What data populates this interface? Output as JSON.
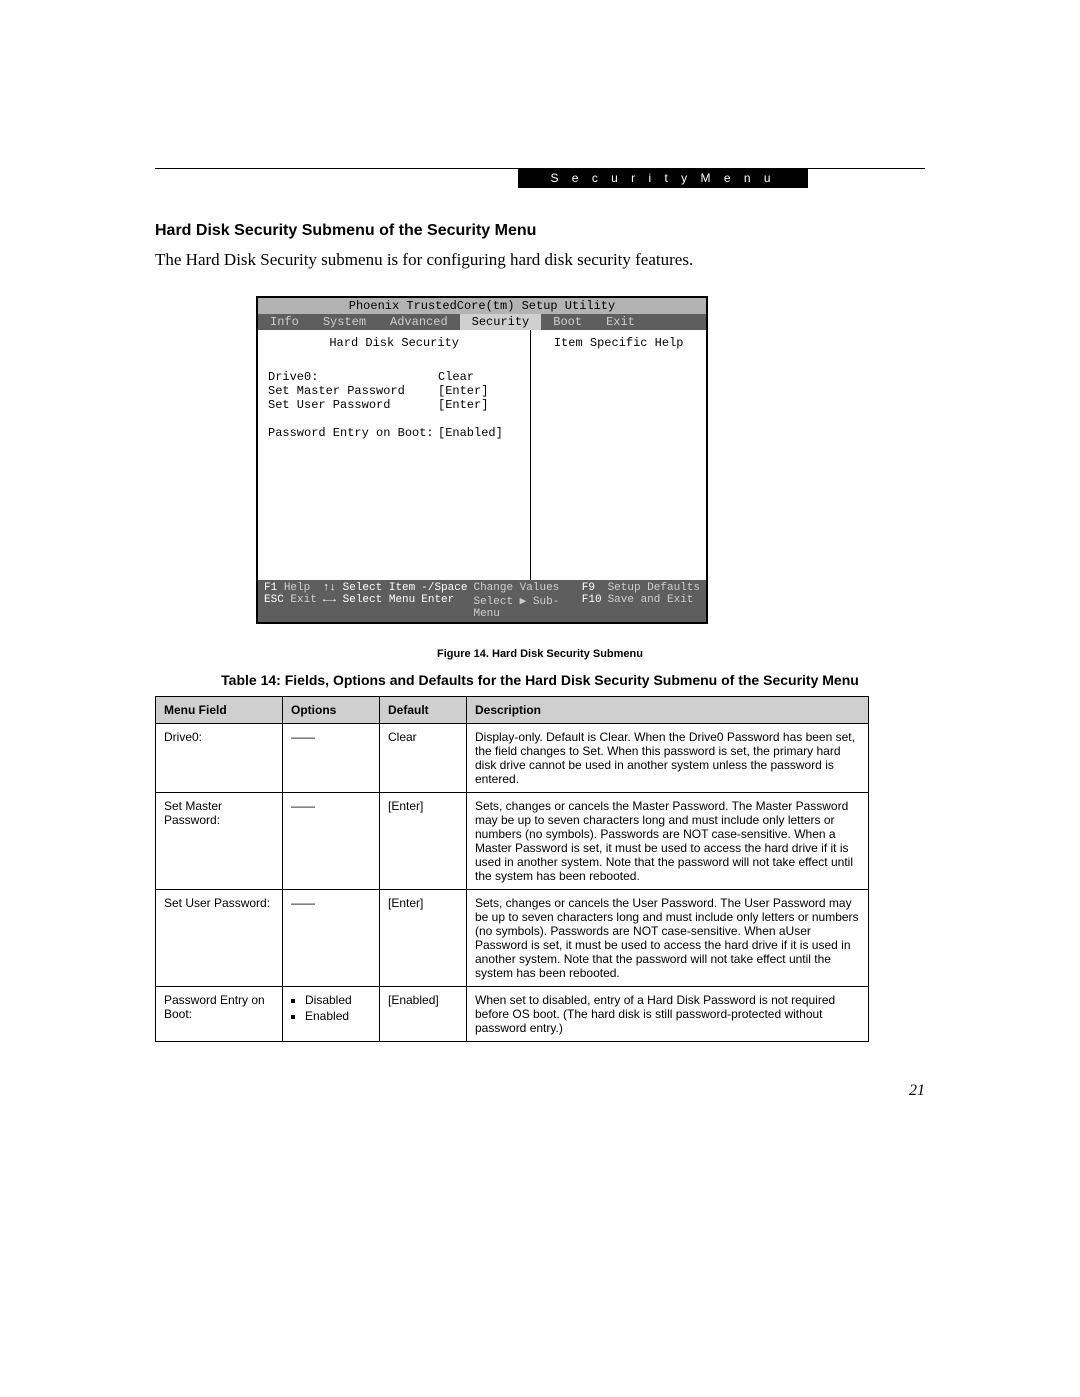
{
  "chip": "S e c u r i t y   M e n u",
  "heading": "Hard Disk Security Submenu of the Security Menu",
  "subtext": "The Hard Disk Security submenu is for configuring hard disk security features.",
  "pageNumber": "21",
  "bios": {
    "title": "Phoenix TrustedCore(tm) Setup Utility",
    "tabs": [
      "Info",
      "System",
      "Advanced",
      "Security",
      "Boot",
      "Exit"
    ],
    "activeTab": "Security",
    "leftTitle": "Hard Disk Security",
    "rightTitle": "Item Specific Help",
    "items": {
      "drive0": {
        "label": "Drive0:",
        "value": "Clear"
      },
      "setMaster": {
        "label": "  Set Master Password",
        "value": "[Enter]"
      },
      "setUser": {
        "label": "  Set User Password",
        "value": "[Enter]"
      },
      "pwdEntry": {
        "label": "Password Entry on Boot:",
        "value": "[Enabled]"
      }
    },
    "footer": {
      "f1": "F1",
      "help": "Help",
      "arrUD": "↑↓ Select Item",
      "space": "-/Space",
      "chg": "Change Values",
      "f9": "F9",
      "sdf": "Setup Defaults",
      "esc": "ESC",
      "exit": "Exit",
      "arrLR": "←→ Select Menu",
      "enter": "Enter",
      "sub": "Select ▶ Sub-Menu",
      "f10": "F10",
      "sae": "Save and Exit"
    }
  },
  "figCaption": "Figure 14.   Hard Disk Security Submenu",
  "tableTitle": "Table 14: Fields, Options and Defaults for the Hard Disk Security Submenu of the Security Menu",
  "headers": {
    "mf": "Menu Field",
    "op": "Options",
    "df": "Default",
    "de": "Description"
  },
  "rows": [
    {
      "menuField": "Drive0:",
      "options": [
        "—"
      ],
      "default": "Clear",
      "description": "Display-only. Default is Clear. When the Drive0 Password has been set, the field changes to Set. When this password is set, the primary hard disk drive cannot be used in another system unless the password is entered."
    },
    {
      "menuField": "Set Master Password:",
      "options": [
        "—"
      ],
      "default": "[Enter]",
      "description": "Sets, changes or cancels the Master Password. The Master Password may be up to seven characters long and must include only letters or numbers (no symbols). Passwords are NOT case-sensitive. When a Master Password is set, it must be used to access the hard drive if it is used in another system. Note that the password will not take effect until the system has been rebooted."
    },
    {
      "menuField": "Set User Password:",
      "options": [
        "—"
      ],
      "default": "[Enter]",
      "description": "Sets, changes or cancels the User Password. The User Password may be up to seven characters long and must include only letters or numbers (no symbols). Passwords are NOT case-sensitive. When aUser Password is set, it must be used to access the hard drive if it is used in another system. Note that the password will not take effect until the system has been rebooted."
    },
    {
      "menuField": "Password Entry on Boot:",
      "options": [
        "Disabled",
        "Enabled"
      ],
      "default": "[Enabled]",
      "description": "When set to disabled, entry of a Hard Disk Password is not required before OS boot. (The hard disk is still password-protected without password entry.)"
    }
  ]
}
